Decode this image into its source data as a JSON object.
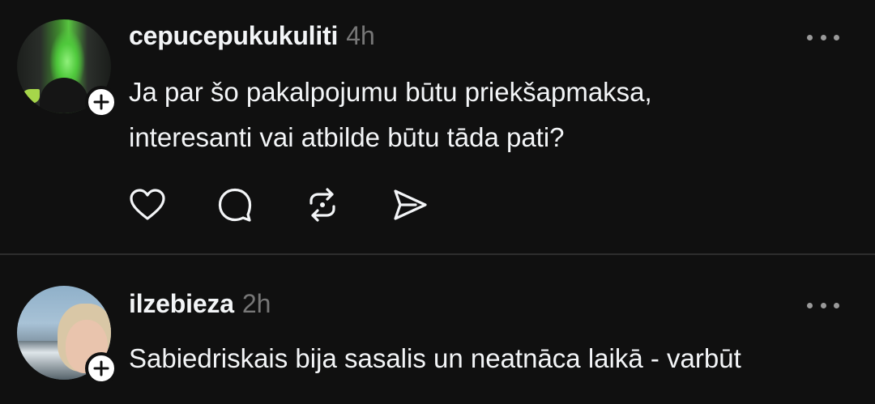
{
  "posts": [
    {
      "username": "cepucepukukuliti",
      "timestamp": "4h",
      "text": "Ja par šo pakalpojumu būtu priekšapmaksa,\ninteresanti vai atbilde būtu tāda pati?",
      "avatar": "profile-photo",
      "actions": [
        "heart-icon",
        "comment-icon",
        "repost-icon",
        "share-icon"
      ]
    },
    {
      "username": "ilzebieza",
      "timestamp": "2h",
      "text": "Sabiedriskais bija sasalis un neatnāca laikā - varbūt",
      "avatar": "profile-photo"
    }
  ],
  "colors": {
    "background": "#101010",
    "text": "#f3f5f7",
    "muted": "#777777",
    "divider": "#2e2e2e"
  }
}
